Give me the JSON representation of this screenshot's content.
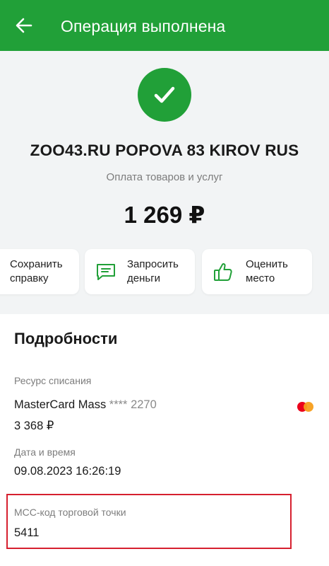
{
  "header": {
    "title": "Операция выполнена",
    "back_icon": "arrow-left-icon",
    "color": "#21a038"
  },
  "status": {
    "icon": "checkmark-icon",
    "merchant": "ZOO43.RU POPOVA 83 KIROV RUS",
    "category": "Оплата товаров и услуг",
    "amount": "1 269 ₽"
  },
  "actions": [
    {
      "label": "Сохранить\nсправку"
    },
    {
      "label": "Запросить\nденьги",
      "icon": "message-icon"
    },
    {
      "label": "Оценить\nместо",
      "icon": "thumbs-up-icon"
    }
  ],
  "details": {
    "title": "Подробности",
    "source_label": "Ресурс списания",
    "card_name": "MasterCard Mass",
    "card_masked": "**** 2270",
    "card_icon": "mastercard-icon",
    "balance": "3 368 ₽",
    "datetime_label": "Дата и время",
    "datetime_value": "09.08.2023 16:26:19",
    "mcc_label": "МСС-код торговой точки",
    "mcc_value": "5411",
    "highlight_color": "#d6202f"
  }
}
